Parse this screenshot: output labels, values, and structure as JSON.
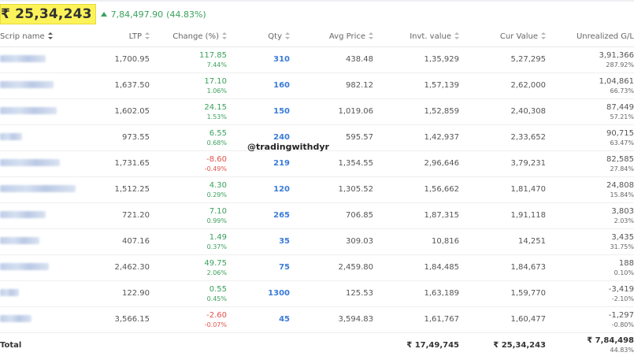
{
  "summary": {
    "total_value": "₹ 25,34,243",
    "pnl_value": "7,84,497.90",
    "pnl_percent": "(44.83%)"
  },
  "watermark": "@tradingwithdyr",
  "columns": {
    "scrip": "Scrip name",
    "ltp": "LTP",
    "change": "Change (%)",
    "qty": "Qty",
    "avg": "Avg Price",
    "inv": "Invt. value",
    "cur": "Cur Value",
    "unr": "Unrealized G/L"
  },
  "rows": [
    {
      "ltp": "1,700.95",
      "chg": "117.85",
      "chg_pct": "7.44%",
      "dir": "pos",
      "qty": "310",
      "avg": "438.48",
      "inv": "1,35,929",
      "cur": "5,27,295",
      "unr": "3,91,366",
      "unr_pct": "287.92%"
    },
    {
      "ltp": "1,637.50",
      "chg": "17.10",
      "chg_pct": "1.06%",
      "dir": "pos",
      "qty": "160",
      "avg": "982.12",
      "inv": "1,57,139",
      "cur": "2,62,000",
      "unr": "1,04,861",
      "unr_pct": "66.73%"
    },
    {
      "ltp": "1,602.05",
      "chg": "24.15",
      "chg_pct": "1.53%",
      "dir": "pos",
      "qty": "150",
      "avg": "1,019.06",
      "inv": "1,52,859",
      "cur": "2,40,308",
      "unr": "87,449",
      "unr_pct": "57.21%"
    },
    {
      "ltp": "973.55",
      "chg": "6.55",
      "chg_pct": "0.68%",
      "dir": "pos",
      "qty": "240",
      "avg": "595.57",
      "inv": "1,42,937",
      "cur": "2,33,652",
      "unr": "90,715",
      "unr_pct": "63.47%"
    },
    {
      "ltp": "1,731.65",
      "chg": "-8.60",
      "chg_pct": "-0.49%",
      "dir": "neg",
      "qty": "219",
      "avg": "1,354.55",
      "inv": "2,96,646",
      "cur": "3,79,231",
      "unr": "82,585",
      "unr_pct": "27.84%"
    },
    {
      "ltp": "1,512.25",
      "chg": "4.30",
      "chg_pct": "0.29%",
      "dir": "pos",
      "qty": "120",
      "avg": "1,305.52",
      "inv": "1,56,662",
      "cur": "1,81,470",
      "unr": "24,808",
      "unr_pct": "15.84%"
    },
    {
      "ltp": "721.20",
      "chg": "7.10",
      "chg_pct": "0.99%",
      "dir": "pos",
      "qty": "265",
      "avg": "706.85",
      "inv": "1,87,315",
      "cur": "1,91,118",
      "unr": "3,803",
      "unr_pct": "2.03%"
    },
    {
      "ltp": "407.16",
      "chg": "1.49",
      "chg_pct": "0.37%",
      "dir": "pos",
      "qty": "35",
      "avg": "309.03",
      "inv": "10,816",
      "cur": "14,251",
      "unr": "3,435",
      "unr_pct": "31.75%"
    },
    {
      "ltp": "2,462.30",
      "chg": "49.75",
      "chg_pct": "2.06%",
      "dir": "pos",
      "qty": "75",
      "avg": "2,459.80",
      "inv": "1,84,485",
      "cur": "1,84,673",
      "unr": "188",
      "unr_pct": "0.10%"
    },
    {
      "ltp": "122.90",
      "chg": "0.55",
      "chg_pct": "0.45%",
      "dir": "pos",
      "qty": "1300",
      "avg": "125.53",
      "inv": "1,63,189",
      "cur": "1,59,770",
      "unr": "-3,419",
      "unr_pct": "-2.10%"
    },
    {
      "ltp": "3,566.15",
      "chg": "-2.60",
      "chg_pct": "-0.07%",
      "dir": "neg",
      "qty": "45",
      "avg": "3,594.83",
      "inv": "1,61,767",
      "cur": "1,60,477",
      "unr": "-1,297",
      "unr_pct": "-0.80%"
    }
  ],
  "total": {
    "label": "Total",
    "inv": "₹ 17,49,745",
    "cur": "₹ 25,34,243",
    "unr": "₹ 7,84,498",
    "unr_pct": "44.83%"
  },
  "colors": {
    "highlight": "#fcf35a",
    "positive": "#3aa15c",
    "negative": "#e0524b",
    "qty": "#3b7bd8"
  }
}
